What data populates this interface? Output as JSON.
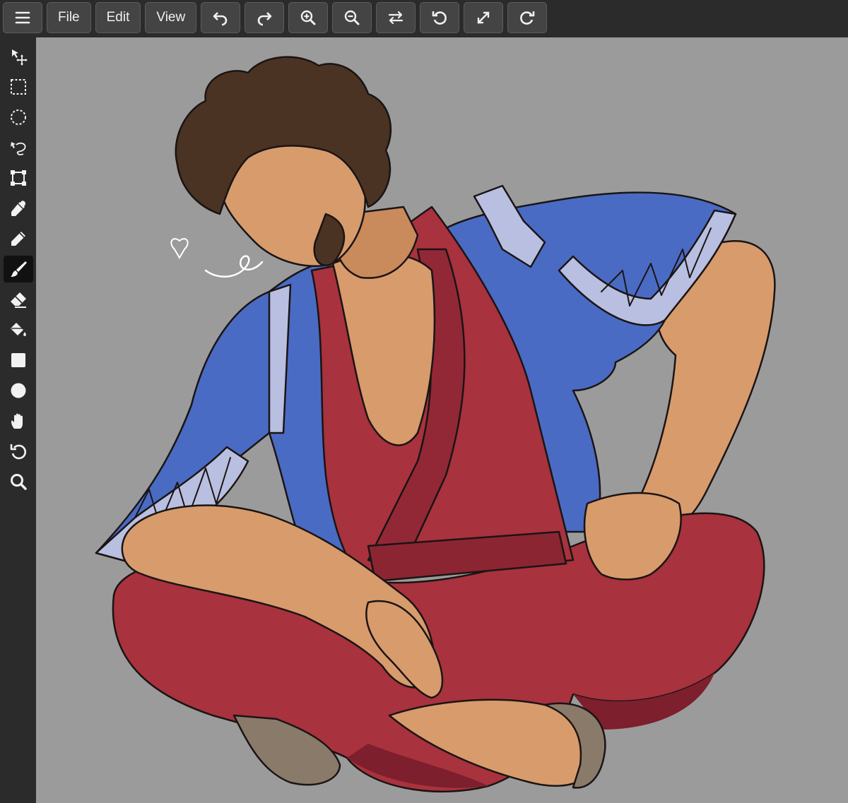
{
  "toolbar": {
    "menu_icon": "hamburger-menu-icon",
    "file_label": "File",
    "edit_label": "Edit",
    "view_label": "View",
    "actions": [
      "undo-icon",
      "redo-icon",
      "zoom-in-icon",
      "zoom-out-icon",
      "flip-horizontal-icon",
      "rotate-left-icon",
      "fit-screen-icon",
      "rotate-right-icon"
    ]
  },
  "tools": {
    "items": [
      "move-icon",
      "rect-select-icon",
      "ellipse-select-icon",
      "lasso-icon",
      "transform-icon",
      "eyedropper-icon",
      "pencil-icon",
      "brush-icon",
      "eraser-icon",
      "paint-bucket-icon",
      "rectangle-icon",
      "ellipse-icon",
      "hand-icon",
      "rotate-view-icon",
      "magnifier-icon"
    ],
    "active": "brush-icon"
  },
  "canvas": {
    "background": "#9b9b9b",
    "artwork": "illustrated-figure"
  },
  "colors": {
    "ui_bg": "#2b2b2b",
    "button_bg": "#444444",
    "robe_red": "#a8323d",
    "robe_red_dark": "#7d1f2c",
    "coat_blue": "#4a6bc4",
    "coat_trim": "#b9bfe0",
    "skin": "#d89b6c",
    "hair": "#4a3322"
  }
}
